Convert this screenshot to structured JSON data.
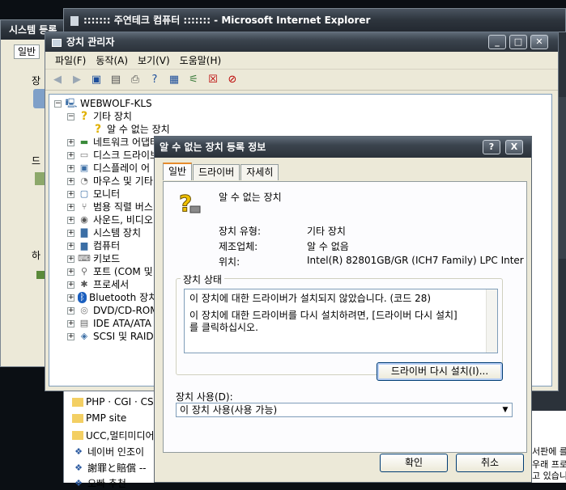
{
  "ie_window": {
    "title": "::::::: 주연테크 컴퓨터 ::::::: - Microsoft Internet Explorer"
  },
  "sys_window": {
    "title": "시스템 등록",
    "tab": "일반",
    "label_d": "드",
    "label_ha": "하",
    "label_jang": "장"
  },
  "devmgr": {
    "title": "장치 관리자",
    "menu": [
      "파일(F)",
      "동작(A)",
      "보기(V)",
      "도움말(H)"
    ],
    "tree": {
      "root": "WEBWOLF-KLS",
      "items": [
        {
          "label": "기타 장치",
          "expanded": true
        },
        {
          "label": "알 수 없는 장치",
          "child": true
        },
        {
          "label": "네트워크 어댑터"
        },
        {
          "label": "디스크 드라이브"
        },
        {
          "label": "디스플레이 어"
        },
        {
          "label": "마우스 및 기타"
        },
        {
          "label": "모니터"
        },
        {
          "label": "범용 직렬 버스"
        },
        {
          "label": "사운드, 비디오"
        },
        {
          "label": "시스템 장치"
        },
        {
          "label": "컴퓨터"
        },
        {
          "label": "키보드"
        },
        {
          "label": "포트 (COM 및"
        },
        {
          "label": "프로세서"
        },
        {
          "label": "Bluetooth 장치"
        },
        {
          "label": "DVD/CD-ROM"
        },
        {
          "label": "IDE ATA/ATA"
        },
        {
          "label": "SCSI 및 RAID"
        }
      ]
    }
  },
  "favorites": {
    "items": [
      "PHP · CGI · CS",
      "PMP site",
      "UCC,멀티미디어",
      "네이버 인조이",
      "謝罪と賠償 --",
      "오빠 추천"
    ]
  },
  "right_window": {
    "line1": "서판에 를",
    "line2": "우래 프로",
    "line3": "고 있습니"
  },
  "dialog": {
    "title": "알 수 없는 장치 등록 정보",
    "help_button": "?",
    "close_button": "X",
    "tabs": [
      "일반",
      "드라이버",
      "자세히"
    ],
    "device_name": "알 수 없는 장치",
    "fields": [
      {
        "label": "장치 유형:",
        "value": "기타 장치"
      },
      {
        "label": "제조업체:",
        "value": "알 수 없음"
      },
      {
        "label": "위치:",
        "value": "Intel(R) 82801GB/GR (ICH7 Family) LPC Inter"
      }
    ],
    "status_legend": "장치 상태",
    "status_line1": "이 장치에 대한 드라이버가 설치되지 않았습니다. (코드 28)",
    "status_line2": "이 장치에 대한 드라이버를 다시 설치하려면, [드라이버 다시 설치]",
    "status_line3": "를 클릭하십시오.",
    "reinstall_button": "드라이버 다시 설치(I)...",
    "usage_label": "장치 사용(D):",
    "usage_value": "이 장치 사용(사용 가능)",
    "ok_button": "확인",
    "cancel_button": "취소"
  }
}
